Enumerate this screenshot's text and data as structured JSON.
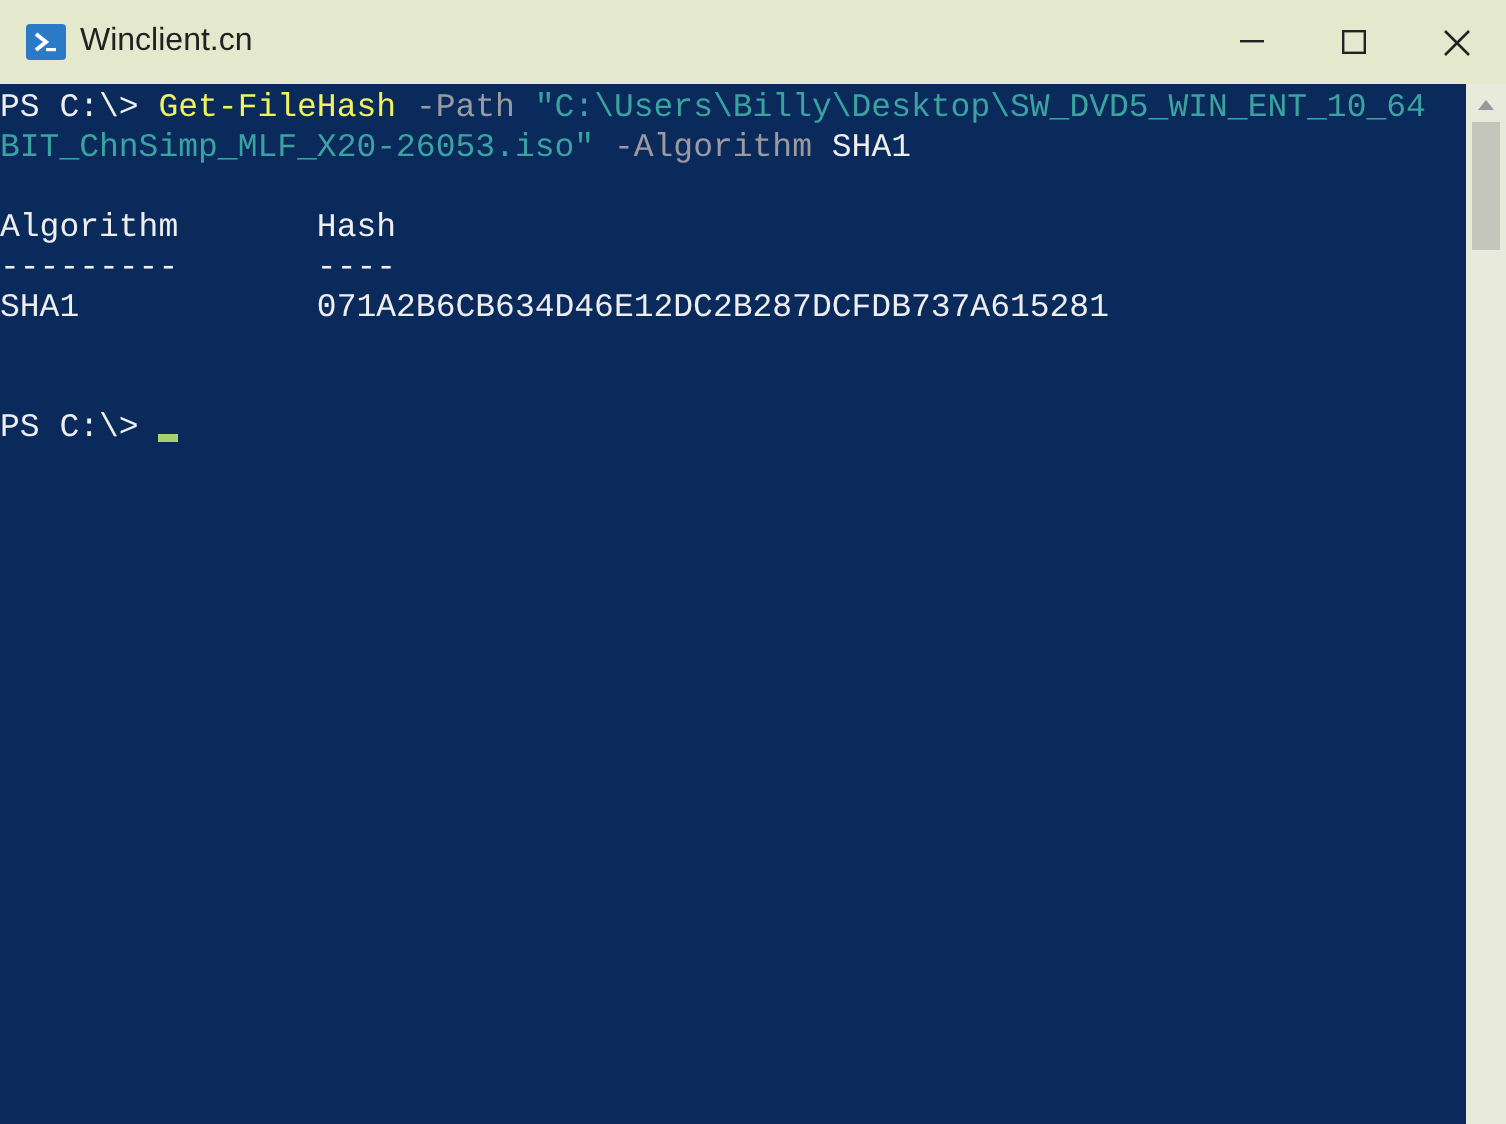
{
  "window": {
    "title": "Winclient.cn"
  },
  "console": {
    "command_lines": [
      {
        "kind": "prompt",
        "text": "PS C:\\> "
      },
      {
        "kind": "command",
        "text": "Get-FileHash"
      },
      {
        "kind": "parameter",
        "text": " -Path "
      },
      {
        "kind": "string",
        "text": "\"C:\\Users\\Billy\\Desktop\\SW_DVD5_WIN_ENT_10_64BIT_ChnSimp_MLF_X20-26053.iso\""
      },
      {
        "kind": "parameter",
        "text": " -Algorithm "
      },
      {
        "kind": "argument",
        "text": "SHA1"
      }
    ],
    "output_table": {
      "columns": [
        {
          "heading": "Algorithm",
          "rule": "---------"
        },
        {
          "heading": "Hash",
          "rule": "----"
        }
      ],
      "rows": [
        [
          "SHA1",
          "071A2B6CB634D46E12DC2B287DCFDB737A615281"
        ]
      ]
    },
    "next_prompt": "PS C:\\> "
  }
}
